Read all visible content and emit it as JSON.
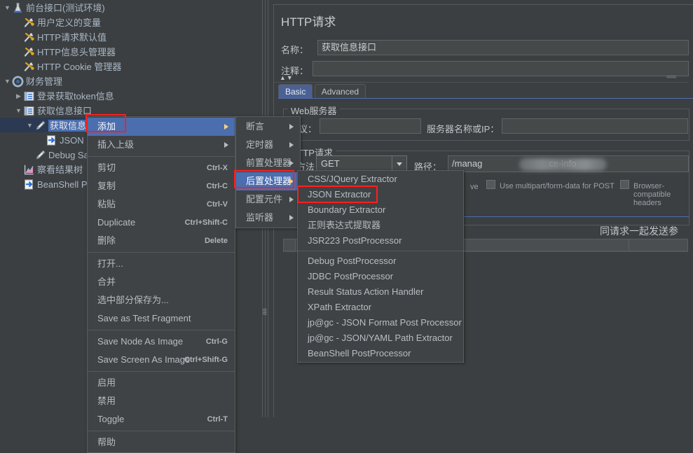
{
  "tree": {
    "items": [
      {
        "label": "前台接口(测试环境)",
        "depth": 0,
        "twisty": "▼",
        "icon": "test-plan-icon",
        "name": "tree-item-test-plan"
      },
      {
        "label": "用户定义的变量",
        "depth": 1,
        "twisty": "",
        "icon": "config-element-icon",
        "name": "tree-item-user-defined-variables"
      },
      {
        "label": "HTTP请求默认值",
        "depth": 1,
        "twisty": "",
        "icon": "config-element-icon",
        "name": "tree-item-http-request-defaults"
      },
      {
        "label": "HTTP信息头管理器",
        "depth": 1,
        "twisty": "",
        "icon": "config-element-icon",
        "name": "tree-item-http-header-manager"
      },
      {
        "label": "HTTP Cookie 管理器",
        "depth": 1,
        "twisty": "",
        "icon": "config-element-icon",
        "name": "tree-item-http-cookie-manager"
      },
      {
        "label": "财务管理",
        "depth": 0,
        "twisty": "▼",
        "icon": "thread-group-icon",
        "name": "tree-item-thread-group"
      },
      {
        "label": "登录获取token信息",
        "depth": 1,
        "twisty": "▶",
        "icon": "controller-icon",
        "name": "tree-item-login-token"
      },
      {
        "label": "获取信息接口",
        "depth": 1,
        "twisty": "▼",
        "icon": "controller-icon",
        "name": "tree-item-get-info-controller"
      },
      {
        "label": "获取信息接口",
        "depth": 2,
        "twisty": "▼",
        "icon": "http-sampler-icon",
        "name": "tree-item-get-info-sampler",
        "selected": true
      },
      {
        "label": "JSON Ex",
        "depth": 3,
        "twisty": "",
        "icon": "post-processor-icon",
        "name": "tree-item-json-extractor"
      },
      {
        "label": "Debug Sam",
        "depth": 2,
        "twisty": "",
        "icon": "http-sampler-icon",
        "name": "tree-item-debug-sampler"
      },
      {
        "label": "察看结果树",
        "depth": 1,
        "twisty": "",
        "icon": "listener-icon",
        "name": "tree-item-view-results-tree"
      },
      {
        "label": "BeanShell Po",
        "depth": 1,
        "twisty": "",
        "icon": "post-processor-icon",
        "name": "tree-item-beanshell-postprocessor"
      }
    ]
  },
  "editor": {
    "title": "HTTP请求",
    "name_label": "名称：",
    "name_value": "获取信息接口",
    "comment_label": "注释：",
    "comment_value": "",
    "tabs": [
      {
        "label": "Basic",
        "active": true
      },
      {
        "label": "Advanced",
        "active": false
      }
    ],
    "web_server": {
      "group_title": "Web服务器",
      "protocol_label": "协议：",
      "protocol_value": "",
      "server_label": "服务器名称或IP：",
      "server_value": ""
    },
    "http_request": {
      "group_title": "HTTP请求",
      "method_label": "方法：",
      "method_value": "GET",
      "path_label": "路径：",
      "path_value_prefix": "/manag",
      "path_value_suffix": "ce-info"
    },
    "options": [
      {
        "label": "Use KeepAlive",
        "checked": false,
        "truncated": "ve"
      },
      {
        "label": "Use multipart/form-data for POST",
        "checked": false
      },
      {
        "label": "Browser-compatible headers",
        "checked": false
      }
    ],
    "params_tab_label": "同请求一起发送参数："
  },
  "context_menu": {
    "items": [
      {
        "label": "添加",
        "accel": "",
        "submenu": true,
        "highlight": true,
        "boxed": true,
        "name": "menu-item-add"
      },
      {
        "label": "插入上级",
        "accel": "",
        "submenu": true,
        "name": "menu-item-insert-parent"
      },
      {
        "sep": true
      },
      {
        "label": "剪切",
        "accel": "Ctrl-X",
        "name": "menu-item-cut"
      },
      {
        "label": "复制",
        "accel": "Ctrl-C",
        "name": "menu-item-copy"
      },
      {
        "label": "粘贴",
        "accel": "Ctrl-V",
        "name": "menu-item-paste"
      },
      {
        "label": "Duplicate",
        "accel": "Ctrl+Shift-C",
        "name": "menu-item-duplicate"
      },
      {
        "label": "删除",
        "accel": "Delete",
        "name": "menu-item-delete"
      },
      {
        "sep": true
      },
      {
        "label": "打开...",
        "accel": "",
        "name": "menu-item-open"
      },
      {
        "label": "合并",
        "accel": "",
        "name": "menu-item-merge"
      },
      {
        "label": "选中部分保存为...",
        "accel": "",
        "name": "menu-item-save-selection-as"
      },
      {
        "label": "Save as Test Fragment",
        "accel": "",
        "name": "menu-item-save-as-test-fragment"
      },
      {
        "sep": true
      },
      {
        "label": "Save Node As Image",
        "accel": "Ctrl-G",
        "name": "menu-item-save-node-as-image"
      },
      {
        "label": "Save Screen As Image",
        "accel": "Ctrl+Shift-G",
        "name": "menu-item-save-screen-as-image"
      },
      {
        "sep": true
      },
      {
        "label": "启用",
        "accel": "",
        "name": "menu-item-enable"
      },
      {
        "label": "禁用",
        "accel": "",
        "name": "menu-item-disable"
      },
      {
        "label": "Toggle",
        "accel": "Ctrl-T",
        "name": "menu-item-toggle"
      },
      {
        "sep": true
      },
      {
        "label": "帮助",
        "accel": "",
        "name": "menu-item-help"
      }
    ]
  },
  "submenu_add": {
    "items": [
      {
        "label": "断言",
        "submenu": true,
        "name": "submenu-item-assertions"
      },
      {
        "label": "定时器",
        "submenu": true,
        "name": "submenu-item-timers"
      },
      {
        "label": "前置处理器",
        "submenu": true,
        "name": "submenu-item-pre-processors"
      },
      {
        "label": "后置处理器",
        "submenu": true,
        "highlight": true,
        "boxed": true,
        "name": "submenu-item-post-processors"
      },
      {
        "label": "配置元件",
        "submenu": true,
        "name": "submenu-item-config-elements"
      },
      {
        "label": "监听器",
        "submenu": true,
        "name": "submenu-item-listeners"
      }
    ]
  },
  "submenu_post_processors": {
    "items": [
      {
        "label": "CSS/JQuery Extractor",
        "name": "submenu-item-css-jquery-extractor"
      },
      {
        "label": "JSON Extractor",
        "boxed": true,
        "name": "submenu-item-json-extractor"
      },
      {
        "label": "Boundary Extractor",
        "name": "submenu-item-boundary-extractor"
      },
      {
        "label": "正则表达式提取器",
        "name": "submenu-item-regex-extractor"
      },
      {
        "label": "JSR223 PostProcessor",
        "name": "submenu-item-jsr223-postprocessor"
      },
      {
        "sep": true
      },
      {
        "label": "Debug PostProcessor",
        "name": "submenu-item-debug-postprocessor"
      },
      {
        "label": "JDBC PostProcessor",
        "name": "submenu-item-jdbc-postprocessor"
      },
      {
        "label": "Result Status Action Handler",
        "name": "submenu-item-result-status-action-handler"
      },
      {
        "label": "XPath Extractor",
        "name": "submenu-item-xpath-extractor"
      },
      {
        "label": "jp@gc - JSON Format Post Processor",
        "name": "submenu-item-jpgc-json-format-post-processor"
      },
      {
        "label": "jp@gc - JSON/YAML Path Extractor",
        "name": "submenu-item-jpgc-json-yaml-path-extractor"
      },
      {
        "label": "BeanShell PostProcessor",
        "name": "submenu-item-beanshell-postprocessor"
      }
    ]
  },
  "colors": {
    "background": "#3c3f41",
    "accent_blue": "#4b6eaf",
    "highlight_red": "#ff1f1f",
    "text": "#b8bdc2"
  }
}
